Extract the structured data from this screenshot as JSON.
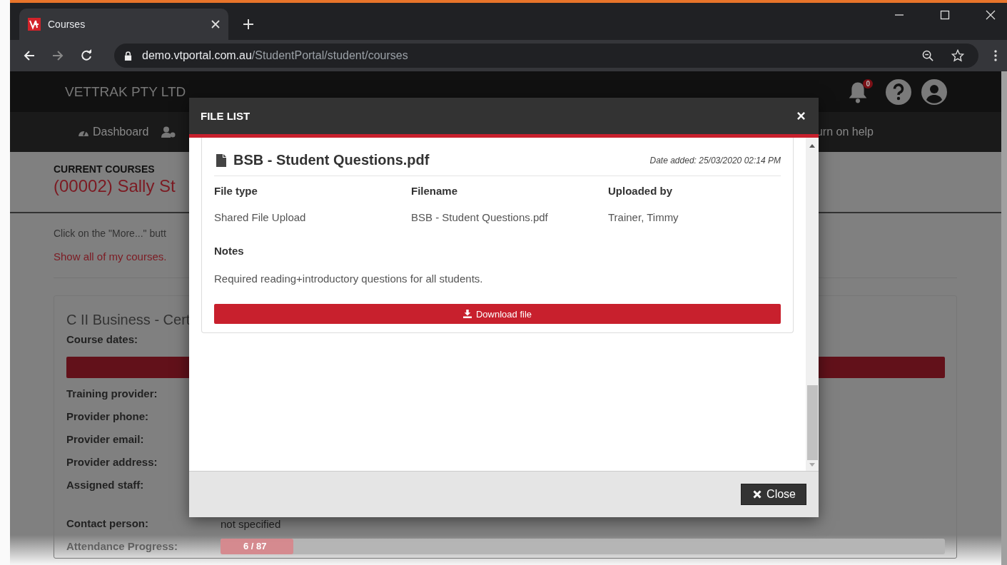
{
  "browser": {
    "tab": {
      "title": "Courses",
      "selected": true
    },
    "url_host": "demo.vtportal.com.au",
    "url_path": "/StudentPortal/student/courses"
  },
  "header": {
    "brand": "VETTRAK PTY LTD",
    "notification_count": "0"
  },
  "nav": {
    "items": [
      {
        "kind": "dashboard",
        "label": "Dashboard"
      },
      {
        "kind": "staff"
      }
    ],
    "help_link": "urn on help"
  },
  "page": {
    "section_label": "CURRENT COURSES",
    "student": "(00002) Sally St",
    "instruction": "Click on the \"More...\" butt",
    "show_all_link": "Show all of my courses.",
    "course": {
      "title": "C II Business - Cert",
      "dates_label": "Course dates:",
      "details": [
        {
          "label": "Training provider:"
        },
        {
          "label": "Provider phone:"
        },
        {
          "label": "Provider email:"
        },
        {
          "label": "Provider address:"
        },
        {
          "label": "Assigned staff:"
        }
      ],
      "contact": {
        "label": "Contact person:",
        "value": "not specified"
      },
      "attendance": {
        "label": "Attendance Progress:",
        "reading": "6 / 87",
        "level": 0.1
      }
    }
  },
  "modal": {
    "title": "FILE LIST",
    "file": {
      "name": "BSB - Student Questions.pdf",
      "date_added": "Date added: 25/03/2020 02:14 PM",
      "columns": [
        {
          "heading": "File type",
          "value": "Shared File Upload"
        },
        {
          "heading": "Filename",
          "value": "BSB - Student Questions.pdf"
        },
        {
          "heading": "Uploaded by",
          "value": "Trainer, Timmy"
        }
      ],
      "notes_heading": "Notes",
      "notes": "Required reading+introductory questions for all students.",
      "download_label": "Download file"
    },
    "close_label": "Close"
  }
}
